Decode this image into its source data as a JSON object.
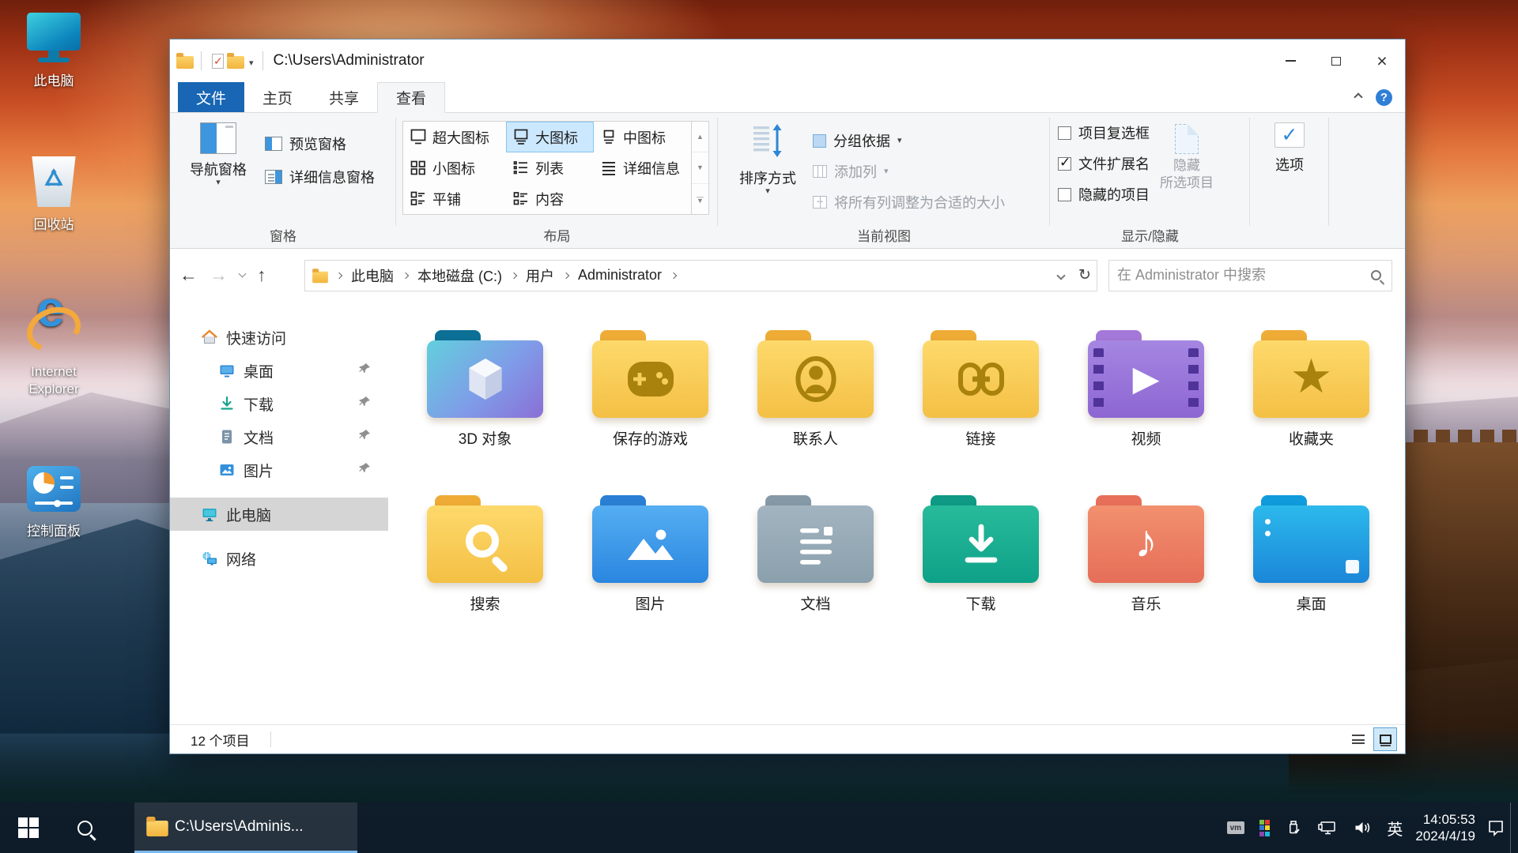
{
  "desktop": {
    "icons": [
      {
        "label": "此电脑",
        "icon": "this-pc"
      },
      {
        "label": "回收站",
        "icon": "recycle-bin"
      },
      {
        "label": "Internet Explorer",
        "icon": "internet-explorer"
      },
      {
        "label": "控制面板",
        "icon": "control-panel"
      }
    ]
  },
  "window": {
    "title": "C:\\Users\\Administrator",
    "tabs": [
      {
        "label": "文件"
      },
      {
        "label": "主页"
      },
      {
        "label": "共享"
      },
      {
        "label": "查看",
        "active": true
      }
    ],
    "ribbon": {
      "nav_pane": "导航窗格",
      "preview_pane": "预览窗格",
      "details_pane": "详细信息窗格",
      "layout_items": [
        {
          "label": "超大图标"
        },
        {
          "label": "大图标",
          "selected": true
        },
        {
          "label": "中图标"
        },
        {
          "label": "小图标"
        },
        {
          "label": "列表"
        },
        {
          "label": "详细信息"
        },
        {
          "label": "平铺"
        },
        {
          "label": "内容"
        }
      ],
      "sort_by": "排序方式",
      "group_by": "分组依据",
      "add_columns": "添加列",
      "fit_columns": "将所有列调整为合适的大小",
      "checkboxes": [
        {
          "label": "项目复选框",
          "checked": false
        },
        {
          "label": "文件扩展名",
          "checked": true
        },
        {
          "label": "隐藏的项目",
          "checked": false
        }
      ],
      "hide_selected": {
        "line1": "隐藏",
        "line2": "所选项目"
      },
      "options": "选项",
      "groups": {
        "panes": "窗格",
        "layout": "布局",
        "current_view": "当前视图",
        "show_hide": "显示/隐藏"
      }
    },
    "navbar": {
      "breadcrumb": [
        "此电脑",
        "本地磁盘 (C:)",
        "用户",
        "Administrator"
      ],
      "search_placeholder": "在 Administrator 中搜索"
    },
    "sidebar": {
      "quick_access": "快速访问",
      "pinned": [
        {
          "label": "桌面"
        },
        {
          "label": "下载"
        },
        {
          "label": "文档"
        },
        {
          "label": "图片"
        }
      ],
      "this_pc": "此电脑",
      "network": "网络"
    },
    "files": [
      {
        "label": "3D 对象",
        "icon": "folder-3d-objects"
      },
      {
        "label": "保存的游戏",
        "icon": "folder-saved-games"
      },
      {
        "label": "联系人",
        "icon": "folder-contacts"
      },
      {
        "label": "链接",
        "icon": "folder-links"
      },
      {
        "label": "视频",
        "icon": "folder-videos"
      },
      {
        "label": "收藏夹",
        "icon": "folder-favorites"
      },
      {
        "label": "搜索",
        "icon": "folder-searches"
      },
      {
        "label": "图片",
        "icon": "folder-pictures"
      },
      {
        "label": "文档",
        "icon": "folder-documents"
      },
      {
        "label": "下载",
        "icon": "folder-downloads"
      },
      {
        "label": "音乐",
        "icon": "folder-music"
      },
      {
        "label": "桌面",
        "icon": "folder-desktop"
      }
    ],
    "statusbar": {
      "count": "12 个项目"
    }
  },
  "taskbar": {
    "app": {
      "label": "C:\\Users\\Adminis..."
    },
    "tray": {
      "vm": "vm",
      "input": "英",
      "time": "14:05:53",
      "date": "2024/4/19"
    }
  },
  "colors": {
    "file_tab_blue": "#1866b4",
    "gallery_selection": "#cce8ff",
    "taskbar_underline": "#7db8ec",
    "folder_yellow": "#f4c045",
    "folder_badge": "#a9820e"
  }
}
